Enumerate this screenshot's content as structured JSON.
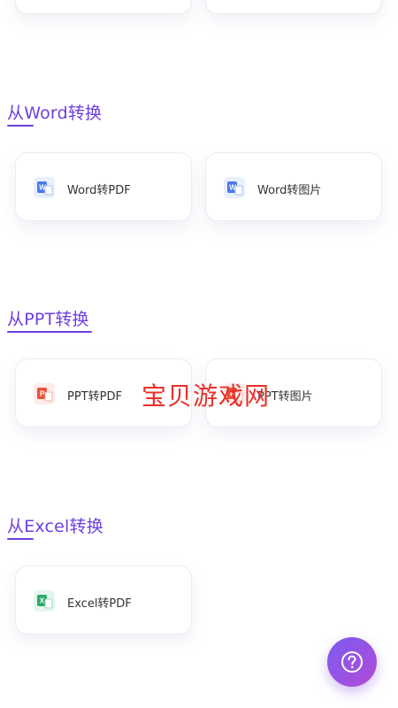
{
  "sections": [
    {
      "title": "从Word转换",
      "items": [
        {
          "label": "Word转PDF",
          "icon": "word-to-pdf-icon"
        },
        {
          "label": "Word转图片",
          "icon": "word-to-image-icon"
        }
      ]
    },
    {
      "title": "从PPT转换",
      "items": [
        {
          "label": "PPT转PDF",
          "icon": "ppt-to-pdf-icon"
        },
        {
          "label": "PPT转图片",
          "icon": "ppt-to-image-icon"
        }
      ]
    },
    {
      "title": "从Excel转换",
      "items": [
        {
          "label": "Excel转PDF",
          "icon": "excel-to-pdf-icon"
        }
      ]
    }
  ],
  "watermark": "宝贝游戏网",
  "help_button": {
    "icon": "question-mark-icon"
  },
  "colors": {
    "accent": "#6d3fe0",
    "word": "#4a7be8",
    "ppt": "#e8533a",
    "excel": "#2ea86a",
    "watermark": "#e8302a"
  }
}
